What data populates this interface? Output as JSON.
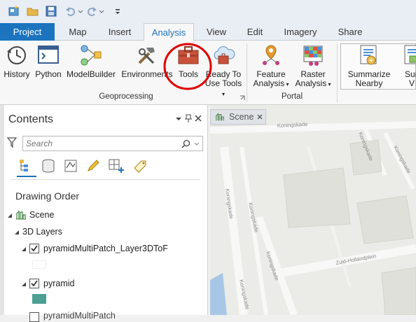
{
  "quick_access": {
    "icons": [
      "new-project-icon",
      "open-icon",
      "save-icon",
      "undo-icon",
      "redo-icon",
      "customize-icon"
    ]
  },
  "tabs": [
    {
      "label": "Project"
    },
    {
      "label": "Map"
    },
    {
      "label": "Insert"
    },
    {
      "label": "Analysis"
    },
    {
      "label": "View"
    },
    {
      "label": "Edit"
    },
    {
      "label": "Imagery"
    },
    {
      "label": "Share"
    }
  ],
  "ribbon": {
    "geoprocessing": {
      "label": "Geoprocessing",
      "buttons": [
        {
          "label": "History"
        },
        {
          "label": "Python"
        },
        {
          "label": "ModelBuilder"
        },
        {
          "label": "Environments"
        },
        {
          "label": "Tools"
        },
        {
          "label": "Ready To",
          "label2": "Use Tools"
        }
      ]
    },
    "portal": {
      "label": "Portal",
      "buttons": [
        {
          "label": "Feature",
          "label2": "Analysis"
        },
        {
          "label": "Raster",
          "label2": "Analysis"
        }
      ]
    },
    "extra": [
      {
        "label": "Summarize",
        "label2": "Nearby"
      },
      {
        "label": "Sur",
        "label2": "V"
      }
    ]
  },
  "contents": {
    "title": "Contents",
    "search_placeholder": "Search",
    "drawing_order": "Drawing Order",
    "tree": {
      "scene": "Scene",
      "layers_3d": "3D Layers",
      "layer1": "pyramidMultiPatch_Layer3DToF",
      "layer2": "pyramid",
      "layer3": "pyramidMultiPatch"
    },
    "layer2_color": "#4d9f94"
  },
  "map": {
    "tab_label": "Scene",
    "street_labels": [
      "Koningskade",
      "Koningskade",
      "Koningskade",
      "Koningskade",
      "Koningskade",
      "Zuid-Hollandplein",
      "Koningskade",
      "Koningskade"
    ]
  },
  "colors": {
    "accent": "#1c73be",
    "highlight_circle": "#e00000"
  }
}
